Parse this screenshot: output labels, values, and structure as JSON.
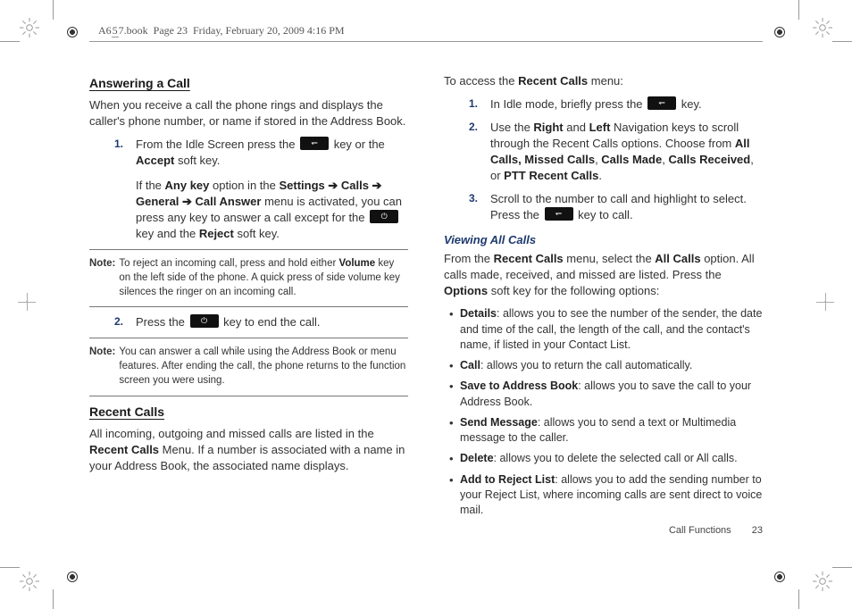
{
  "header": {
    "book": "A657.book",
    "page_ref": "Page 23",
    "date_time": "Friday, February 20, 2009  4:16 PM",
    "underlined_char": "5"
  },
  "left": {
    "h1": "Answering a Call",
    "intro": "When you receive a call the phone rings and displays the caller's phone number, or name if stored in the Address Book.",
    "step1_a": "From the Idle Screen press the ",
    "step1_b": " key or the ",
    "step1_c": "Accept",
    "step1_d": " soft key.",
    "step1_p2_a": "If the ",
    "step1_p2_b": "Any key",
    "step1_p2_c": " option in the ",
    "step1_p2_d": "Settings ➔ Calls ➔  General ➔ Call Answer",
    "step1_p2_e": " menu is activated, you can press any key to answer a call except for the ",
    "step1_p2_f": " key and the ",
    "step1_p2_g": "Reject",
    "step1_p2_h": " soft key.",
    "note1_label": "Note:",
    "note1": "To reject an incoming call, press and hold either Volume key on the left side of the phone. A quick press of side volume key silences the ringer on an incoming call.",
    "note1_bold": "Volume",
    "step2_a": "Press the ",
    "step2_b": " key to end the call.",
    "note2_label": "Note:",
    "note2": "You can answer a call while using the Address Book or menu features. After ending the call, the phone returns to the function screen you were using.",
    "h2": "Recent Calls",
    "recent_p_a": "All incoming, outgoing and missed calls are listed in the ",
    "recent_p_b": "Recent Calls",
    "recent_p_c": " Menu. If a number is associated with a name in your Address Book, the associated name displays."
  },
  "right": {
    "access_a": "To access the ",
    "access_b": "Recent Calls",
    "access_c": " menu:",
    "r1_a": "In Idle mode, briefly press the ",
    "r1_b": " key.",
    "r2_a": "Use the ",
    "r2_b": "Right",
    "r2_c": " and ",
    "r2_d": "Left",
    "r2_e": " Navigation keys to scroll through the Recent Calls options. Choose from ",
    "r2_f": "All Calls, Missed Calls",
    "r2_g": ", ",
    "r2_h": "Calls Made",
    "r2_i": ", ",
    "r2_j": "Calls Received",
    "r2_k": ", or ",
    "r2_l": "PTT Recent Calls",
    "r2_m": ".",
    "r3_a": "Scroll to the number to call and highlight to select. Press the ",
    "r3_b": " key to call.",
    "h3": "Viewing All Calls",
    "view_p_a": "From the ",
    "view_p_b": "Recent Calls",
    "view_p_c": " menu, select the ",
    "view_p_d": "All Calls",
    "view_p_e": " option. All calls made, received, and missed are listed. Press the ",
    "view_p_f": "Options",
    "view_p_g": " soft key for the following options:",
    "bul1_a": "Details",
    "bul1_b": ": allows you to see the number of the sender, the date and time of the call, the length of the call, and the contact's name, if listed in your Contact List.",
    "bul2_a": "Call",
    "bul2_b": ": allows you to return the call automatically.",
    "bul3_a": "Save to Address Book",
    "bul3_b": ": allows you to save the call to your Address Book.",
    "bul4_a": "Send Message",
    "bul4_b": ": allows you to send a text or Multimedia message to the caller.",
    "bul5_a": "Delete",
    "bul5_b": ": allows you to delete the selected call or All calls.",
    "bul6_a": "Add to Reject List",
    "bul6_b": ": allows you to add the sending number to your Reject List, where incoming calls are sent direct to voice mail."
  },
  "footer": {
    "section": "Call Functions",
    "page": "23"
  }
}
